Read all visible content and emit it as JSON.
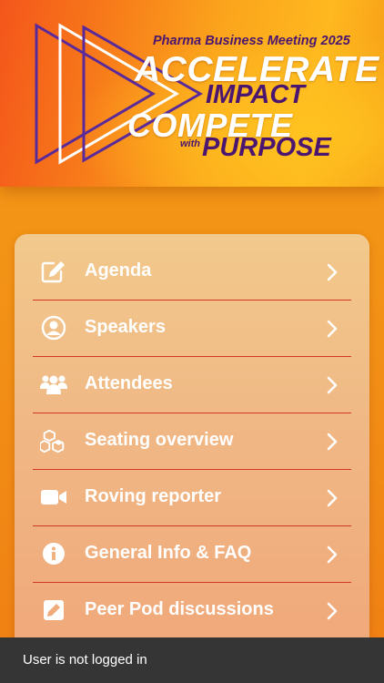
{
  "banner": {
    "subtitle": "Pharma Business Meeting 2025",
    "line1": "ACCELERATE",
    "line2": "IMPACT",
    "line3": "COMPETE",
    "with": "with",
    "line4": "PURPOSE"
  },
  "menu": {
    "items": [
      {
        "label": "Agenda",
        "icon": "edit-icon"
      },
      {
        "label": "Speakers",
        "icon": "user-circle-icon"
      },
      {
        "label": "Attendees",
        "icon": "users-icon"
      },
      {
        "label": "Seating overview",
        "icon": "cubes-icon"
      },
      {
        "label": "Roving reporter",
        "icon": "video-camera-icon"
      },
      {
        "label": "General Info & FAQ",
        "icon": "info-icon"
      },
      {
        "label": "Peer Pod discussions",
        "icon": "pencil-square-icon"
      }
    ]
  },
  "footer": {
    "status": "User is not logged in"
  },
  "colors": {
    "background": "#f39316",
    "accent_purple": "#4a1670",
    "divider": "#d2381f",
    "footer": "#353535"
  }
}
